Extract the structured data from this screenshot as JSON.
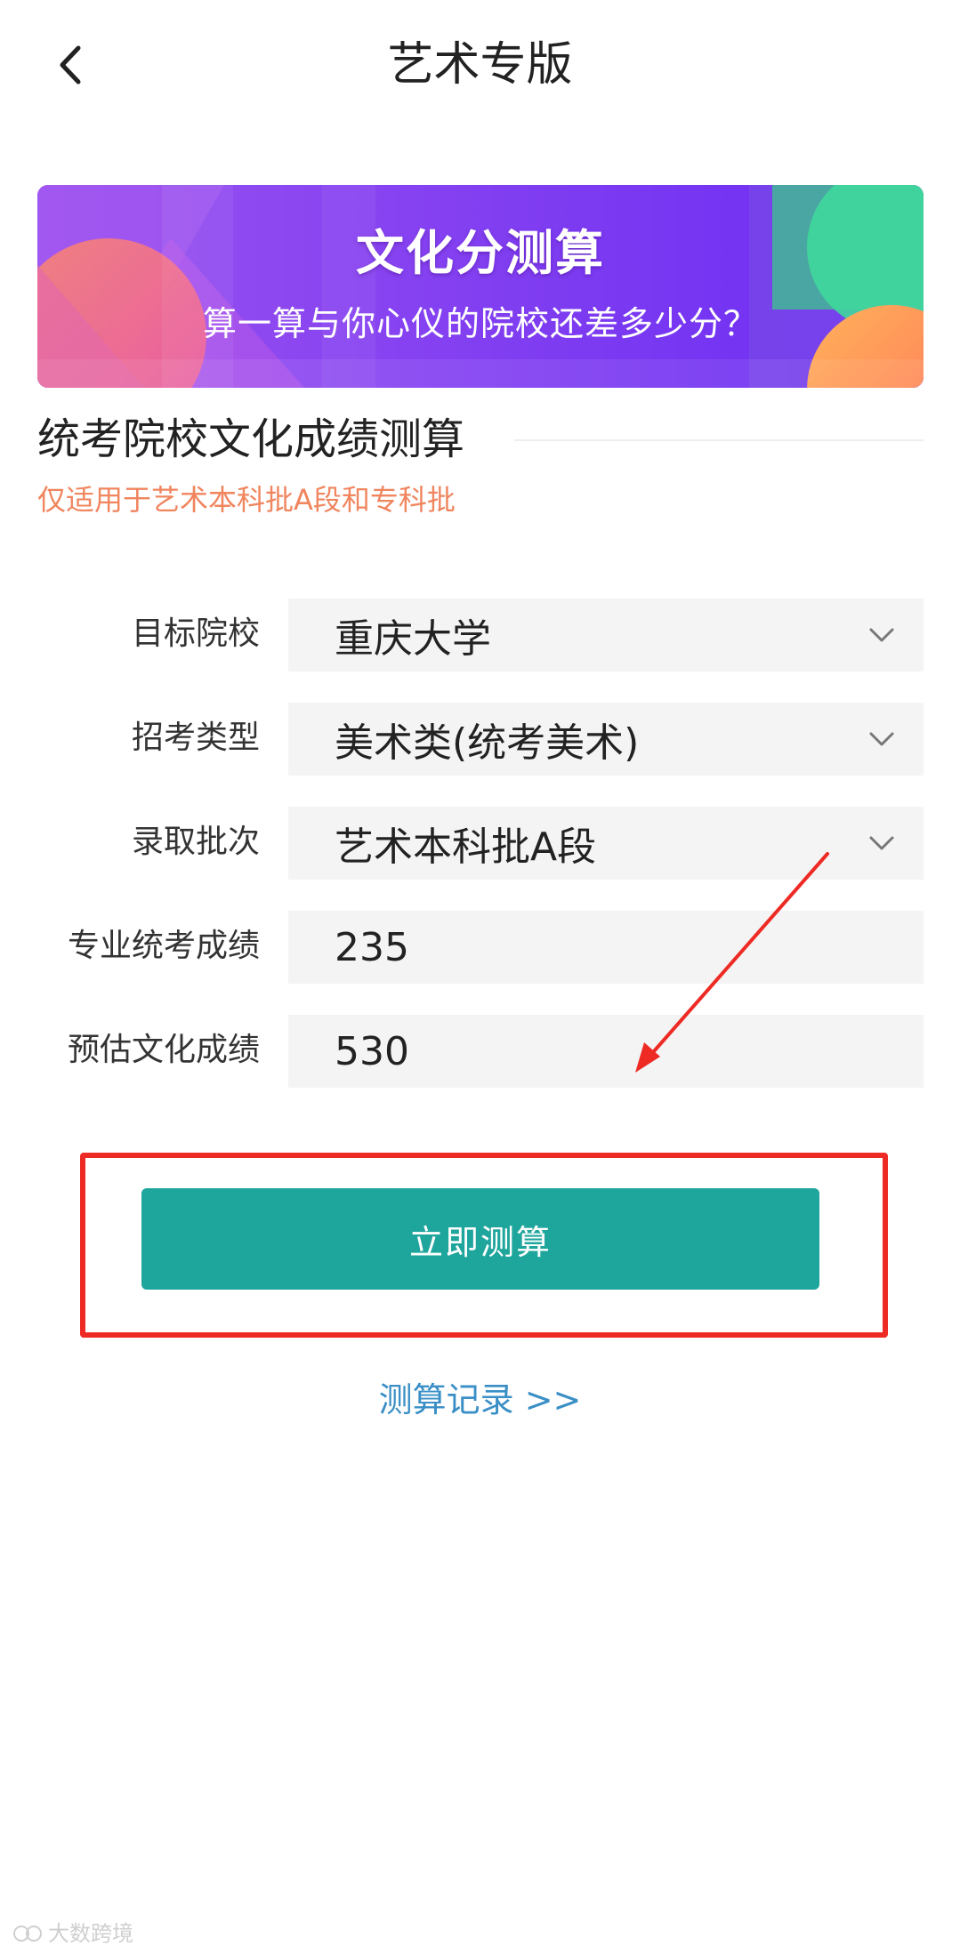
{
  "header": {
    "title": "艺术专版",
    "back_icon": "chevron-left-icon"
  },
  "banner": {
    "title": "文化分测算",
    "subtitle": "算一算与你心仪的院校还差多少分？"
  },
  "section": {
    "title": "统考院校文化成绩测算",
    "note": "仅适用于艺术本科批A段和专科批"
  },
  "form": {
    "target_school": {
      "label": "目标院校",
      "value": "重庆大学",
      "icon": "chevron-down-icon"
    },
    "exam_type": {
      "label": "招考类型",
      "value": "美术类(统考美术)",
      "icon": "chevron-down-icon"
    },
    "batch": {
      "label": "录取批次",
      "value": "艺术本科批A段",
      "icon": "chevron-down-icon"
    },
    "major_score": {
      "label": "专业统考成绩",
      "value": "235"
    },
    "culture_score": {
      "label": "预估文化成绩",
      "value": "530"
    }
  },
  "actions": {
    "calculate_label": "立即测算",
    "records_link": "测算记录 >>"
  },
  "annotations": {
    "highlight_color": "#ee2a24"
  },
  "watermark": {
    "text": "大数跨境"
  },
  "colors": {
    "accent": "#1ea59c",
    "note": "#f0855e",
    "link": "#3a8fc6",
    "banner": "#6c2cf5"
  }
}
